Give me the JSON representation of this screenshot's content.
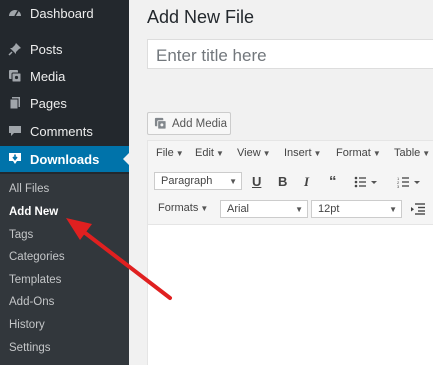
{
  "sidebar": {
    "items": [
      {
        "label": "Dashboard",
        "icon": "dashboard-icon"
      },
      {
        "label": "Posts",
        "icon": "pin-icon"
      },
      {
        "label": "Media",
        "icon": "media-icon"
      },
      {
        "label": "Pages",
        "icon": "pages-icon"
      },
      {
        "label": "Comments",
        "icon": "comments-icon"
      },
      {
        "label": "Downloads",
        "icon": "download-icon"
      }
    ],
    "submenu": [
      {
        "label": "All Files"
      },
      {
        "label": "Add New"
      },
      {
        "label": "Tags"
      },
      {
        "label": "Categories"
      },
      {
        "label": "Templates"
      },
      {
        "label": "Add-Ons"
      },
      {
        "label": "History"
      },
      {
        "label": "Settings"
      }
    ],
    "current_submenu": "Add New"
  },
  "main": {
    "page_title": "Add New File",
    "title_placeholder": "Enter title here",
    "add_media_label": "Add Media"
  },
  "editor": {
    "menubar": [
      "File",
      "Edit",
      "View",
      "Insert",
      "Format",
      "Table"
    ],
    "block_format": "Paragraph",
    "formats_label": "Formats",
    "font_family": "Arial",
    "font_size": "12pt"
  },
  "colors": {
    "sidebar_bg": "#23282d",
    "submenu_bg": "#32373c",
    "active_bg": "#0073aa",
    "arrow": "#e02020"
  }
}
